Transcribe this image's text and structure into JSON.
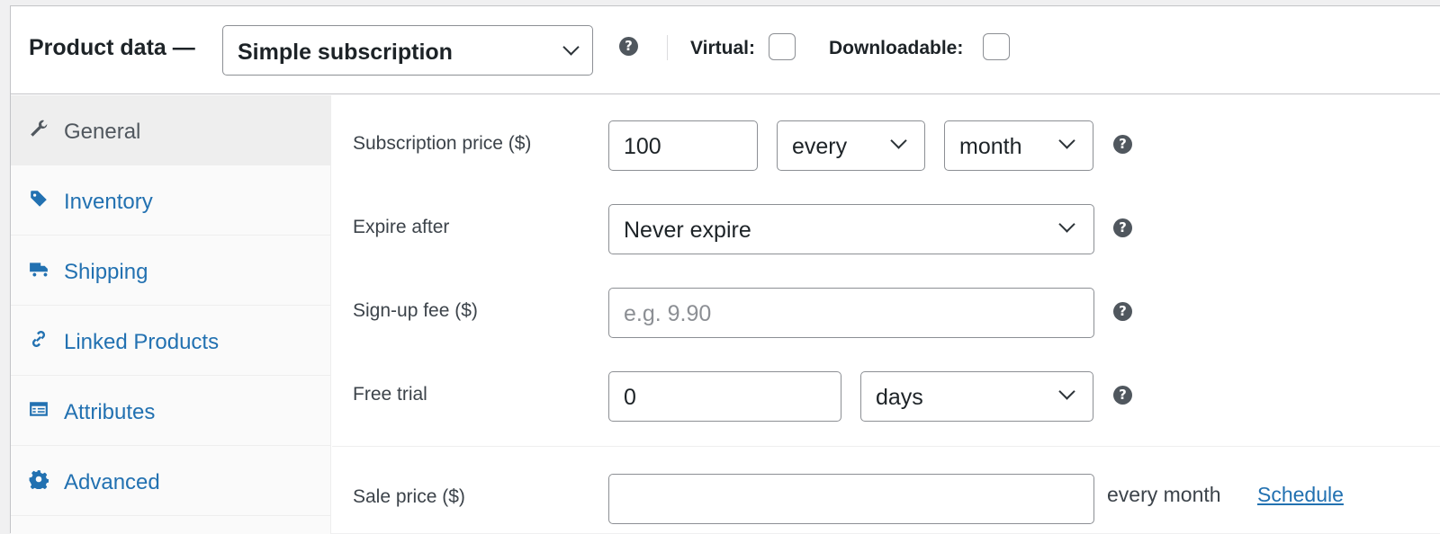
{
  "header": {
    "title": "Product data —",
    "product_type": "Simple subscription",
    "virtual_label": "Virtual:",
    "downloadable_label": "Downloadable:"
  },
  "tabs": [
    {
      "label": "General",
      "icon": "wrench-icon"
    },
    {
      "label": "Inventory",
      "icon": "tag-icon"
    },
    {
      "label": "Shipping",
      "icon": "truck-icon"
    },
    {
      "label": "Linked Products",
      "icon": "link-icon"
    },
    {
      "label": "Attributes",
      "icon": "list-icon"
    },
    {
      "label": "Advanced",
      "icon": "gear-icon"
    }
  ],
  "fields": {
    "subscription_price": {
      "label": "Subscription price ($)",
      "value": "100",
      "interval": "every",
      "period": "month"
    },
    "expire_after": {
      "label": "Expire after",
      "value": "Never expire"
    },
    "signup_fee": {
      "label": "Sign-up fee ($)",
      "placeholder": "e.g. 9.90"
    },
    "free_trial": {
      "label": "Free trial",
      "value": "0",
      "period": "days"
    },
    "sale_price": {
      "label": "Sale price ($)",
      "value": "",
      "suffix": "every month",
      "schedule_link": "Schedule"
    }
  },
  "help_glyph": "?",
  "colors": {
    "link": "#2271b1",
    "border": "#8c8f94",
    "help": "#50575e"
  }
}
